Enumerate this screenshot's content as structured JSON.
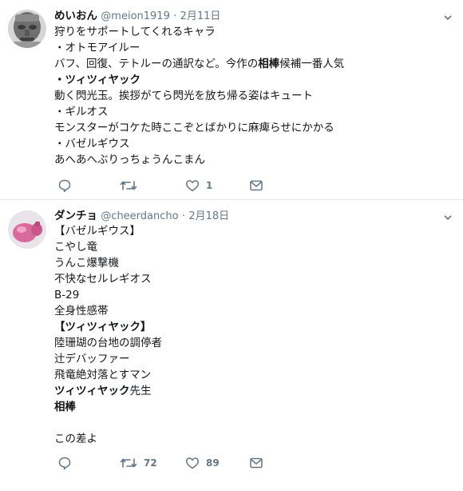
{
  "tweets": [
    {
      "user": {
        "name": "めいおん",
        "handle": "@meion1919"
      },
      "separator": "·",
      "date": "2月11日",
      "lines": [
        [
          {
            "t": "狩りをサポートしてくれるキャラ"
          }
        ],
        [
          {
            "t": "・オトモアイルー"
          }
        ],
        [
          {
            "t": "バフ、回復、テトルーの通訳など。今作の"
          },
          {
            "t": "相棒",
            "b": true
          },
          {
            "t": "候補一番人気"
          }
        ],
        [
          {
            "t": "・ツィツィヤック",
            "b": true
          }
        ],
        [
          {
            "t": "動く閃光玉。挨拶がてら閃光を放ち帰る姿はキュート"
          }
        ],
        [
          {
            "t": "・ギルオス"
          }
        ],
        [
          {
            "t": "モンスターがコケた時ここぞとばかりに麻痺らせにかかる"
          }
        ],
        [
          {
            "t": "・バゼルギウス"
          }
        ],
        [
          {
            "t": "あへあへぶりっちょうんこまん"
          }
        ]
      ],
      "actions": {
        "reply": "",
        "retweet": "",
        "like": "1",
        "dm": ""
      }
    },
    {
      "user": {
        "name": "ダンチョ",
        "handle": "@cheerdancho"
      },
      "separator": "·",
      "date": "2月18日",
      "lines": [
        [
          {
            "t": "【バゼルギウス】"
          }
        ],
        [
          {
            "t": "こやし竜"
          }
        ],
        [
          {
            "t": "うんこ爆撃機"
          }
        ],
        [
          {
            "t": "不快なセルレギオス"
          }
        ],
        [
          {
            "t": "B-29"
          }
        ],
        [
          {
            "t": "全身性感帯"
          }
        ],
        [
          {
            "t": "【ツィツィヤック】",
            "b": true
          }
        ],
        [
          {
            "t": "陸珊瑚の台地の調停者"
          }
        ],
        [
          {
            "t": "辻デバッファー"
          }
        ],
        [
          {
            "t": "飛竜絶対落とすマン"
          }
        ],
        [
          {
            "t": "ツィツィヤック",
            "b": true
          },
          {
            "t": "先生"
          }
        ],
        [
          {
            "t": "相棒",
            "b": true
          }
        ],
        [
          {
            "t": ""
          }
        ],
        [
          {
            "t": "この差よ"
          }
        ]
      ],
      "actions": {
        "reply": "",
        "retweet": "72",
        "like": "89",
        "dm": ""
      }
    }
  ],
  "colors": {
    "text": "#14171a",
    "muted": "#657786",
    "divider": "#e6ecf0",
    "icon": "#657786"
  },
  "icons": [
    "reply-icon",
    "retweet-icon",
    "like-icon",
    "dm-icon",
    "caret-down-icon"
  ]
}
